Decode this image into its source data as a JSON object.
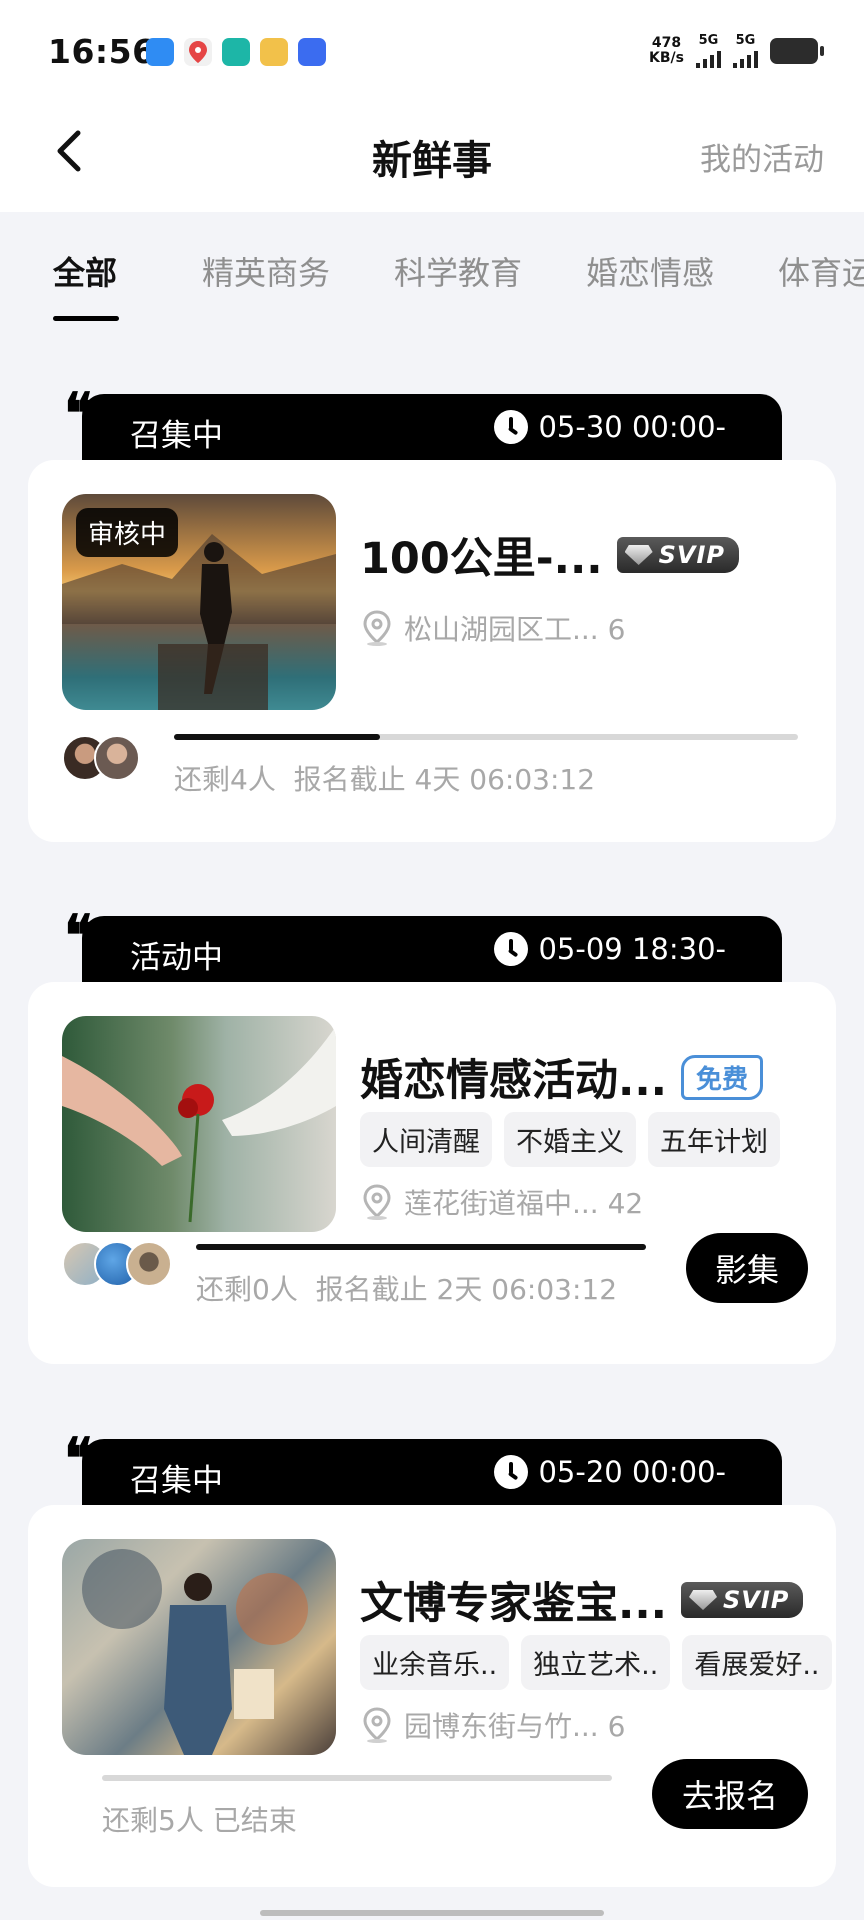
{
  "status_bar": {
    "time": "16:56",
    "speed_value": "478",
    "speed_unit": "KB/s",
    "net1": "5G",
    "net2": "5G",
    "app_badge": "BOSS直聘"
  },
  "header": {
    "title": "新鲜事",
    "my_activities": "我的活动"
  },
  "tabs": [
    {
      "label": "全部",
      "active": true
    },
    {
      "label": "精英商务"
    },
    {
      "label": "科学教育"
    },
    {
      "label": "婚恋情感"
    },
    {
      "label": "体育运"
    }
  ],
  "cards": [
    {
      "status": "召集中",
      "time": "05-30 00:00-",
      "review_tag": "审核中",
      "title": "100公里-...",
      "badge": "SVIP",
      "location": "松山湖园区工... 6",
      "progress": 0.33,
      "remaining": "还剩4人",
      "deadline": "报名截止 4天 06:03:12"
    },
    {
      "status": "活动中",
      "time": "05-09 18:30-",
      "title": "婚恋情感活动...",
      "badge": "免费",
      "tags": [
        "人间清醒",
        "不婚主义",
        "五年计划"
      ],
      "location": "莲花街道福中... 42",
      "progress": 1.0,
      "remaining": "还剩0人",
      "deadline": "报名截止 2天 06:03:12",
      "button": "影集"
    },
    {
      "status": "召集中",
      "time": "05-20 00:00-",
      "title": "文博专家鉴宝...",
      "badge": "SVIP",
      "tags": [
        "业余音乐..",
        "独立艺术..",
        "看展爱好.."
      ],
      "location": "园博东街与竹... 6",
      "progress": 0.0,
      "remaining": "还剩5人",
      "deadline": "已结束",
      "button": "去报名"
    }
  ]
}
